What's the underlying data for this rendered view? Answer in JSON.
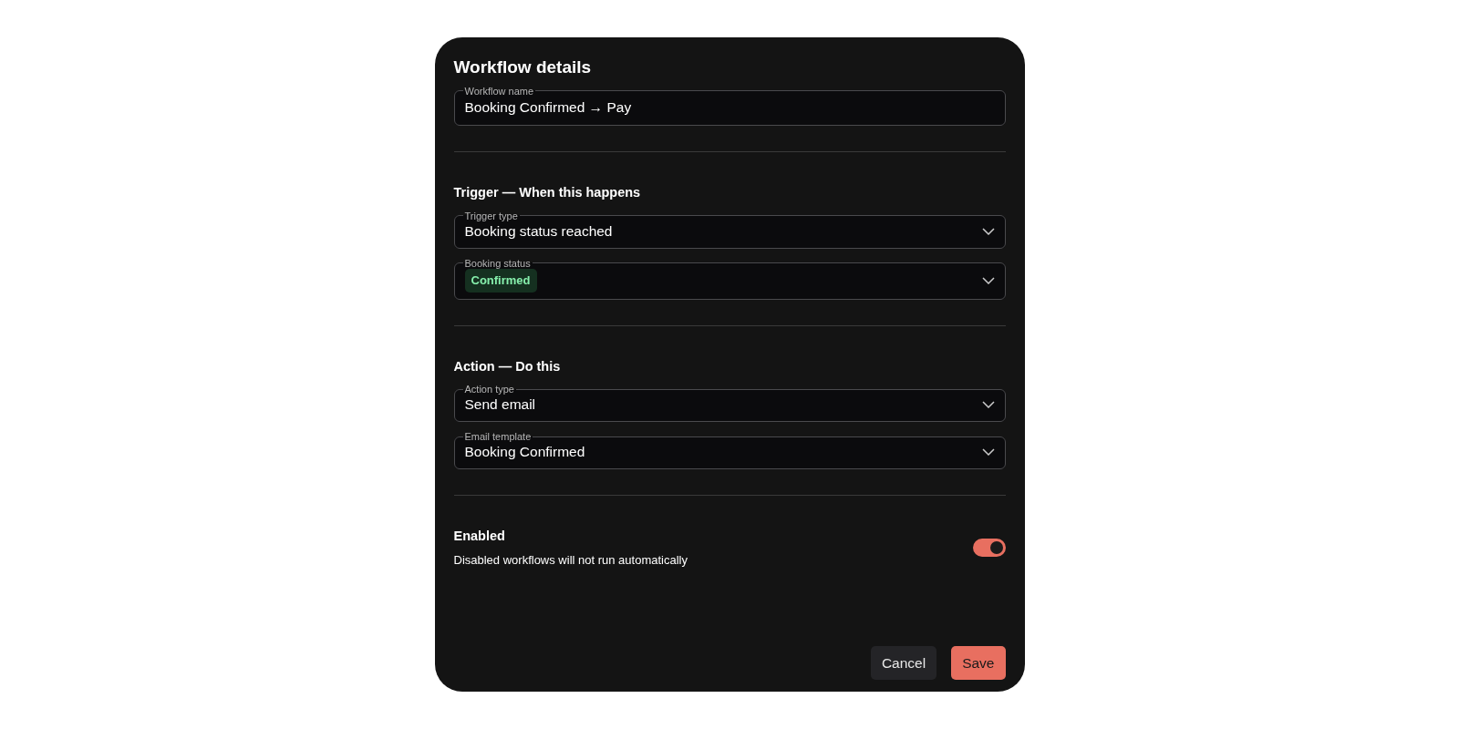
{
  "dialog": {
    "title": "Workflow details"
  },
  "name_field": {
    "label": "Workflow name",
    "value": "Booking Confirmed → Pay"
  },
  "sections": [
    {
      "heading": "Trigger — When this happens",
      "fields": [
        {
          "kind": "select",
          "label": "Trigger type",
          "value": "Booking status reached"
        },
        {
          "kind": "tags",
          "label": "Booking status",
          "tags": [
            {
              "text": "Confirmed",
              "color": "#153020"
            }
          ]
        }
      ]
    },
    {
      "heading": "Action — Do this",
      "fields": [
        {
          "kind": "select",
          "label": "Action type",
          "value": "Send email"
        },
        {
          "kind": "select",
          "label": "Email template",
          "value": "Booking Confirmed"
        }
      ]
    }
  ],
  "enabled": {
    "label": "Enabled",
    "description": "Disabled workflows will not run automatically",
    "on": true
  },
  "buttons": [
    {
      "label": "Cancel",
      "kind": "secondary"
    },
    {
      "label": "Save",
      "kind": "primary"
    }
  ]
}
